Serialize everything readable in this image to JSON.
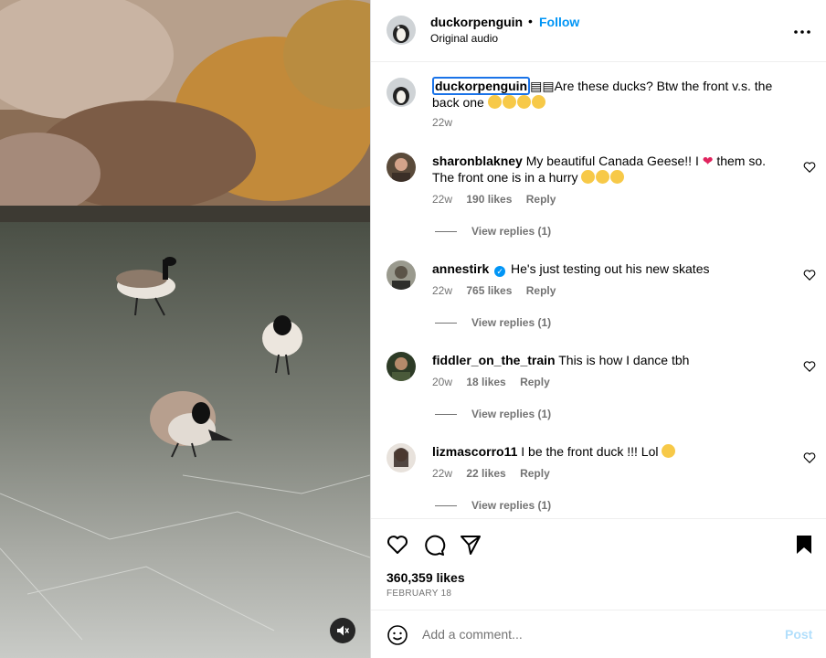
{
  "header": {
    "username": "duckorpenguin",
    "separator": "•",
    "follow_label": "Follow",
    "audio": "Original audio"
  },
  "caption": {
    "username": "duckorpenguin",
    "text": "Are these ducks? Btw the front v.s. the back one",
    "time": "22w"
  },
  "comments": [
    {
      "username": "sharonblakney",
      "text_before": "My beautiful Canada Geese!! I",
      "text_after": "them so. The front one is in a hurry",
      "time": "22w",
      "likes": "190 likes",
      "reply": "Reply",
      "view_replies": "View replies (1)"
    },
    {
      "username": "annestirk",
      "verified": true,
      "text": "He's just testing out his new skates",
      "time": "22w",
      "likes": "765 likes",
      "reply": "Reply",
      "view_replies": "View replies (1)"
    },
    {
      "username": "fiddler_on_the_train",
      "text": "This is how I dance tbh",
      "time": "20w",
      "likes": "18 likes",
      "reply": "Reply",
      "view_replies": "View replies (1)"
    },
    {
      "username": "lizmascorro11",
      "text": "I be the front duck !!! Lol",
      "time": "22w",
      "likes": "22 likes",
      "reply": "Reply",
      "view_replies": "View replies (1)"
    }
  ],
  "post": {
    "likes": "360,359 likes",
    "date": "FEBRUARY 18"
  },
  "composer": {
    "placeholder": "Add a comment...",
    "post_label": "Post"
  },
  "icons": {
    "more": "more-options-icon",
    "like": "heart-icon",
    "comment": "comment-icon",
    "share": "share-icon",
    "save": "bookmark-icon",
    "emoji": "smiley-icon",
    "mute": "mute-icon"
  },
  "colors": {
    "accent": "#0095f6",
    "post_disabled": "#b2dffc",
    "secondary_text": "#737373",
    "caption_focus": "#1a73e8"
  }
}
